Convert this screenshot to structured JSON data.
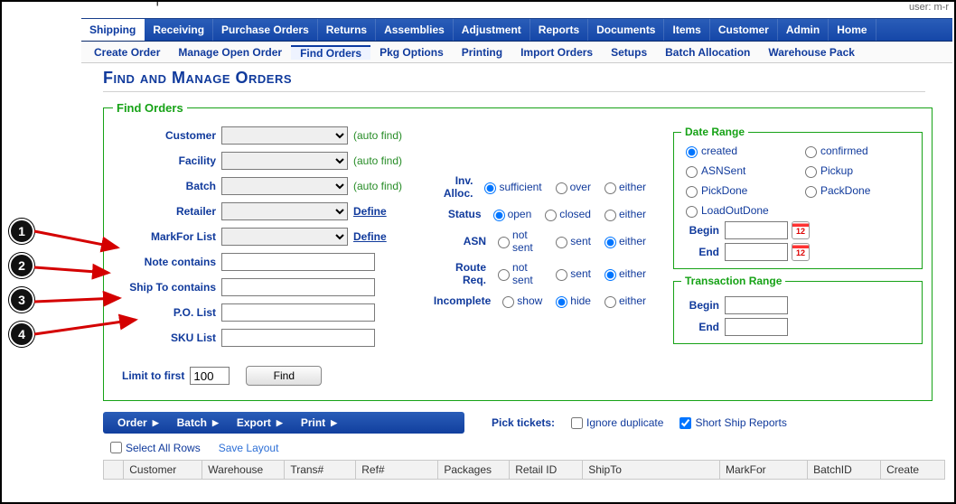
{
  "user_bar": "user: m-r",
  "main_nav": {
    "items": [
      "Shipping",
      "Receiving",
      "Purchase Orders",
      "Returns",
      "Assemblies",
      "Adjustment",
      "Reports",
      "Documents",
      "Items",
      "Customer",
      "Admin",
      "Home"
    ],
    "active_index": 0
  },
  "sub_nav": {
    "items": [
      "Create Order",
      "Manage Open Order",
      "Find Orders",
      "Pkg Options",
      "Printing",
      "Import Orders",
      "Setups",
      "Batch Allocation",
      "Warehouse Pack"
    ],
    "active_index": 2
  },
  "page_title": "Find and Manage Orders",
  "find": {
    "legend": "Find Orders",
    "customer": {
      "label": "Customer",
      "hint": "(auto find)"
    },
    "facility": {
      "label": "Facility",
      "hint": "(auto find)"
    },
    "batch": {
      "label": "Batch",
      "hint": "(auto find)"
    },
    "retailer": {
      "label": "Retailer",
      "define": "Define"
    },
    "markfor": {
      "label": "MarkFor List",
      "define": "Define"
    },
    "note": {
      "label": "Note contains"
    },
    "shipto": {
      "label": "Ship To contains"
    },
    "polist": {
      "label": "P.O. List"
    },
    "skulist": {
      "label": "SKU List"
    },
    "limit": {
      "label": "Limit to first",
      "value": "100",
      "button": "Find"
    }
  },
  "filters": {
    "inv_alloc": {
      "label": "Inv. Alloc.",
      "options": [
        "sufficient",
        "over",
        "either"
      ],
      "selected": 0
    },
    "status": {
      "label": "Status",
      "options": [
        "open",
        "closed",
        "either"
      ],
      "selected": 0
    },
    "asn": {
      "label": "ASN",
      "options": [
        "not sent",
        "sent",
        "either"
      ],
      "selected": 2
    },
    "route_req": {
      "label": "Route Req.",
      "options": [
        "not sent",
        "sent",
        "either"
      ],
      "selected": 2
    },
    "incomplete": {
      "label": "Incomplete",
      "options": [
        "show",
        "hide",
        "either"
      ],
      "selected": 1
    }
  },
  "date_range": {
    "legend": "Date Range",
    "options": [
      "created",
      "confirmed",
      "ASNSent",
      "Pickup",
      "PickDone",
      "PackDone",
      "LoadOutDone"
    ],
    "selected": 0,
    "begin_label": "Begin",
    "end_label": "End",
    "cal_day": "12"
  },
  "trans_range": {
    "legend": "Transaction Range",
    "begin_label": "Begin",
    "end_label": "End"
  },
  "action_bar": {
    "items": [
      "Order",
      "Batch",
      "Export",
      "Print"
    ]
  },
  "pick_tickets": {
    "label": "Pick tickets:",
    "ignore": "Ignore duplicate",
    "short": "Short Ship Reports",
    "ignore_checked": false,
    "short_checked": true
  },
  "select_all": "Select All Rows",
  "save_layout": "Save Layout",
  "grid_cols": [
    "Customer",
    "Warehouse",
    "Trans#",
    "Ref#",
    "Packages",
    "Retail ID",
    "ShipTo",
    "MarkFor",
    "BatchID",
    "Create"
  ],
  "annotations": {
    "labels": [
      "1",
      "2",
      "3",
      "4"
    ]
  }
}
